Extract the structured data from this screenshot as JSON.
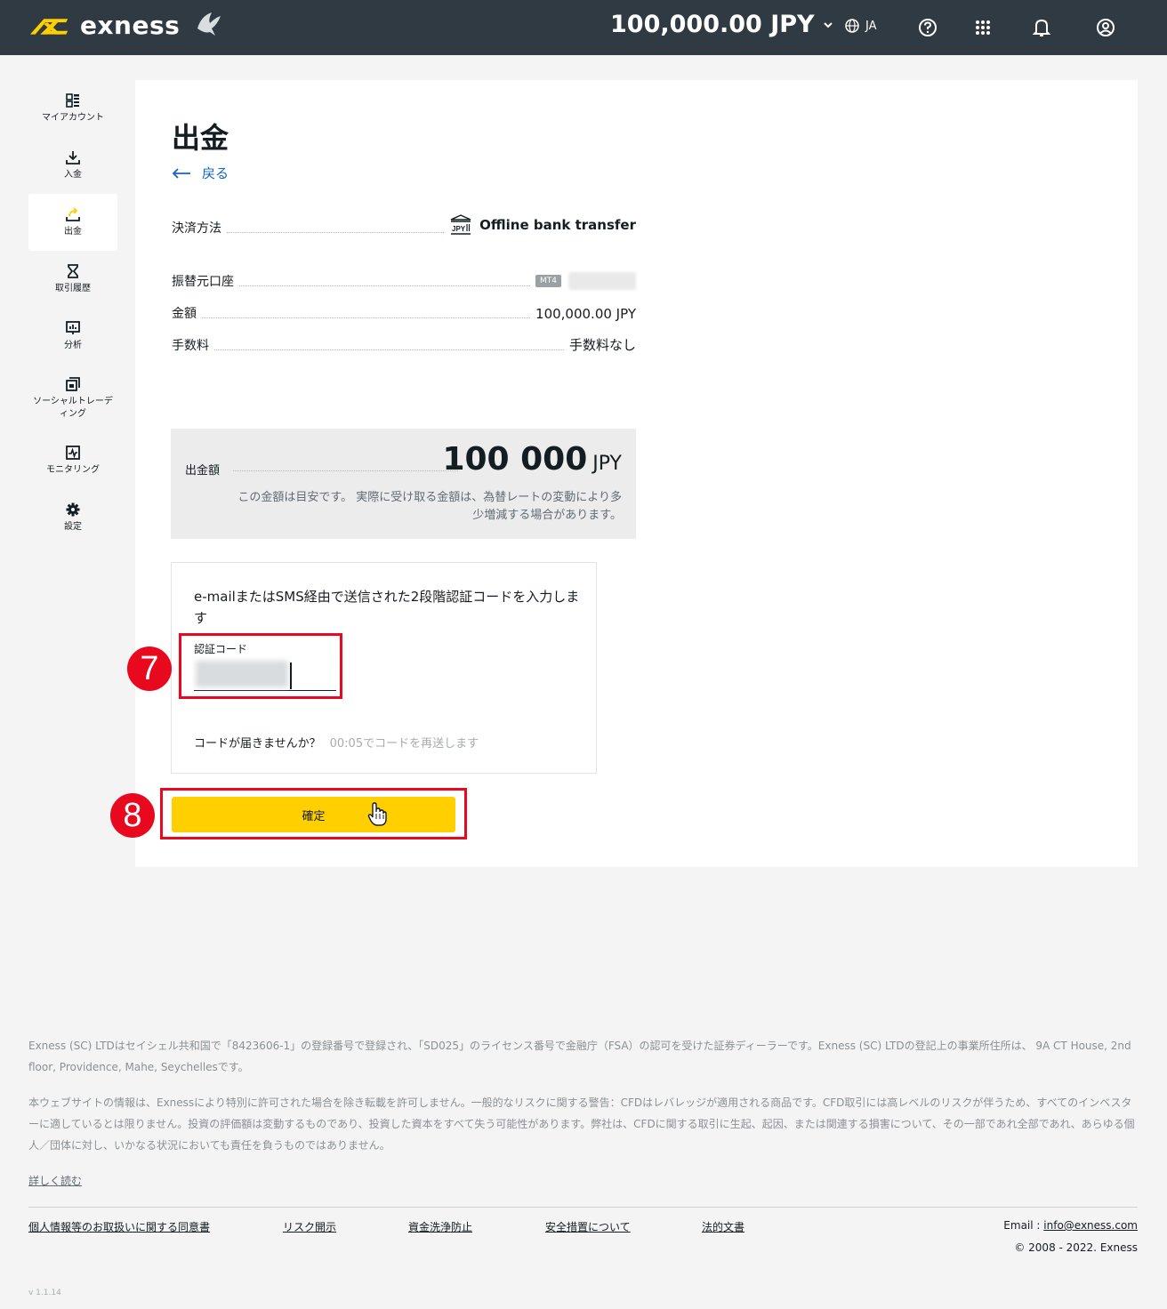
{
  "header": {
    "logo_text": "exness",
    "balance": "100,000.00 JPY",
    "lang": "JA"
  },
  "sidebar": {
    "items": [
      {
        "label": "マイアカウント",
        "icon": "dashboard-icon"
      },
      {
        "label": "入金",
        "icon": "download-icon"
      },
      {
        "label": "出金",
        "icon": "withdraw-icon"
      },
      {
        "label": "取引履歴",
        "icon": "hourglass-icon"
      },
      {
        "label": "分析",
        "icon": "analytics-icon"
      },
      {
        "label": "ソーシャルトレーディング",
        "icon": "social-trading-icon"
      },
      {
        "label": "モニタリング",
        "icon": "monitoring-icon"
      },
      {
        "label": "設定",
        "icon": "gear-icon"
      }
    ]
  },
  "main": {
    "title": "出金",
    "back": "戻る",
    "method_label": "決済方法",
    "method_icon_text": "JPY",
    "method_value": "Offline bank transfer",
    "account_label": "振替元口座",
    "account_badge": "MT4",
    "amount_label": "金額",
    "amount_value": "100,000.00 JPY",
    "fee_label": "手数料",
    "fee_value": "手数料なし",
    "withdraw_label": "出金額",
    "withdraw_amount": "100 000",
    "withdraw_currency": "JPY",
    "note": "この金額は目安です。 実際に受け取る金額は、為替レートの変動により多少増減する場合があります。",
    "otp_message": "e-mailまたはSMS経由で送信された2段階認証コードを入力します",
    "otp_field_label": "認証コード",
    "resend_question": "コードが届きませんか？",
    "resend_timer": "00:05でコードを再送します",
    "confirm_label": "確定",
    "step7": "7",
    "step8": "8"
  },
  "footer": {
    "p1": "Exness (SC) LTDはセイシェル共和国で「8423606-1」の登録番号で登録され、「SD025」のライセンス番号で金融庁（FSA）の認可を受けた証券ディーラーです。Exness (SC) LTDの登記上の事業所住所は、 9A CT House, 2nd floor, Providence, Mahe, Seychellesです。",
    "p2": "本ウェブサイトの情報は、Exnessにより特別に許可された場合を除き転載を許可しません。一般的なリスクに関する警告：CFDはレバレッジが適用される商品です。CFD取引には高レベルのリスクが伴うため、すべてのインベスターに適しているとは限りません。投資の評価額は変動するものであり、投資した資本をすべて失う可能性があります。弊社は、CFDに関する取引に生起、起因、または関連する損害について、その一部であれ全部であれ、あらゆる個人／団体に対し、いかなる状況においても責任を負うものではありません。",
    "read_more": "詳しく読む",
    "links": [
      "個人情報等のお取扱いに関する同意書",
      "リスク開示",
      "資金洗浄防止",
      "安全措置について",
      "法的文書"
    ],
    "email_label": "Email :",
    "email": "info@exness.com",
    "copyright": "© 2008 - 2022. Exness",
    "version": "v 1.1.14"
  },
  "colors": {
    "header_bg": "#2f3a42",
    "accent": "#ffcf00",
    "link": "#1566bc",
    "highlight": "#e8091e"
  }
}
